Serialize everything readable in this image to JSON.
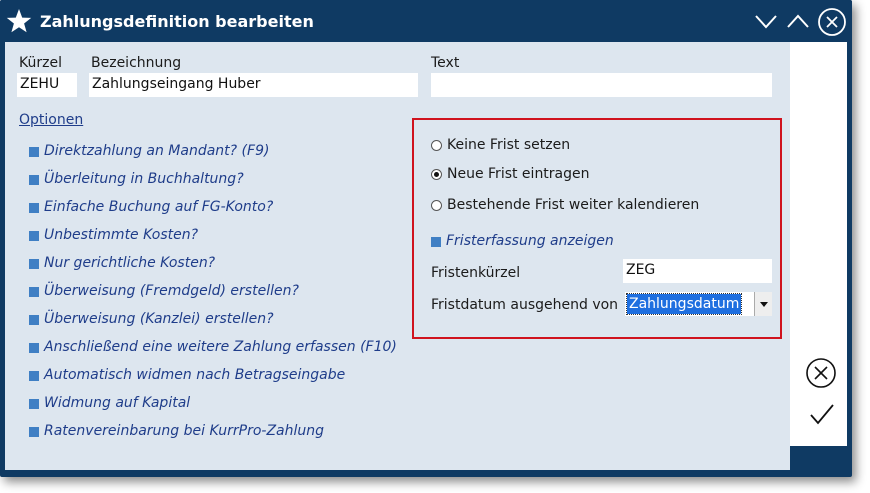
{
  "window": {
    "title": "Zahlungsdefinition bearbeiten",
    "colors": {
      "titlebar": "#0f3a63",
      "content": "#dde6ef",
      "accent": "#3f7fc4",
      "highlight_border": "#d0131e"
    }
  },
  "form": {
    "kuerzel_label": "Kürzel",
    "kuerzel_value": "ZEHU",
    "bezeichnung_label": "Bezeichnung",
    "bezeichnung_value": "Zahlungseingang Huber",
    "text_label": "Text",
    "text_value": ""
  },
  "options": {
    "heading": "Optionen",
    "items": [
      {
        "label": "Direktzahlung an Mandant? (F9)"
      },
      {
        "label": "Überleitung in Buchhaltung?"
      },
      {
        "label": "Einfache Buchung auf FG-Konto?"
      },
      {
        "label": "Unbestimmte Kosten?"
      },
      {
        "label": "Nur gerichtliche Kosten?"
      },
      {
        "label": "Überweisung (Fremdgeld) erstellen?"
      },
      {
        "label": "Überweisung (Kanzlei) erstellen?"
      },
      {
        "label": "Anschließend eine weitere Zahlung erfassen (F10)"
      },
      {
        "label": "Automatisch widmen nach Betragseingabe"
      },
      {
        "label": "Widmung auf Kapital"
      },
      {
        "label": "Ratenvereinbarung bei KurrPro-Zahlung"
      }
    ]
  },
  "frist": {
    "radios": [
      {
        "label": "Keine Frist setzen",
        "selected": false
      },
      {
        "label": "Neue Frist eintragen",
        "selected": true
      },
      {
        "label": "Bestehende Frist weiter kalendieren",
        "selected": false
      }
    ],
    "erfassung_label": "Fristerfassung anzeigen",
    "kuerzel_label": "Fristenkürzel",
    "kuerzel_value": "ZEG",
    "datum_label": "Fristdatum ausgehend von",
    "datum_value": "Zahlungsdatum"
  },
  "icons": {
    "title": "star-icon",
    "minimize": "chevron-down-icon",
    "maximize": "chevron-up-icon",
    "close": "close-circle-icon",
    "cancel": "cancel-circle-icon",
    "confirm": "checkmark-icon"
  }
}
